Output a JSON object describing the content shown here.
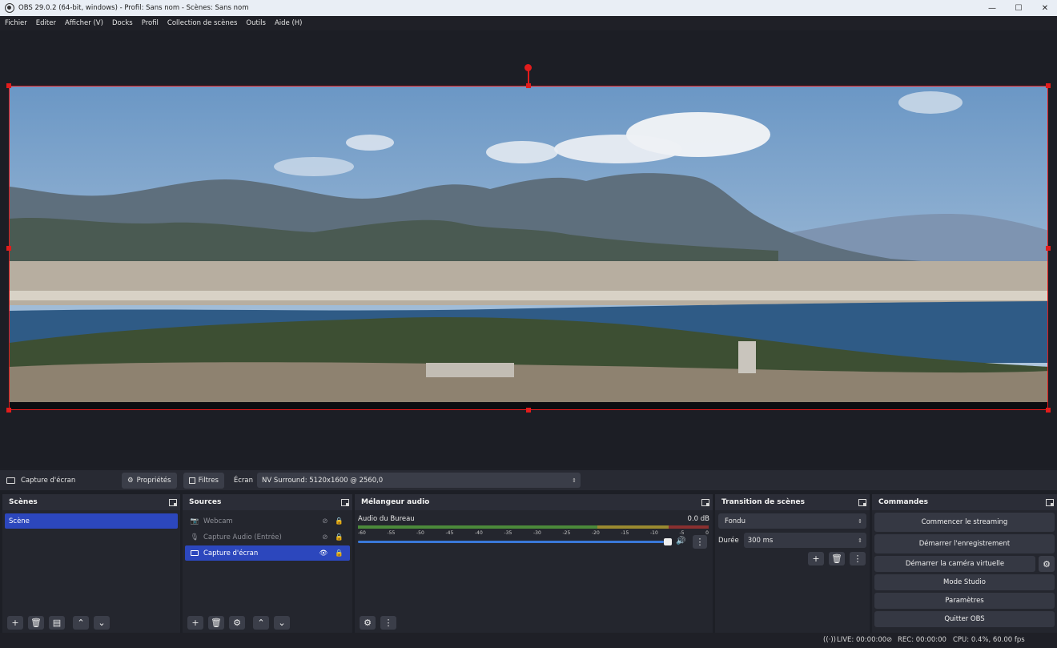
{
  "window": {
    "title": "OBS 29.0.2 (64-bit, windows) - Profil: Sans nom - Scènes: Sans nom",
    "minimize": "—",
    "maximize": "☐",
    "close": "✕"
  },
  "menu": [
    "Fichier",
    "Editer",
    "Afficher (V)",
    "Docks",
    "Profil",
    "Collection de scènes",
    "Outils",
    "Aide (H)"
  ],
  "source_toolbar": {
    "source_name": "Capture d'écran",
    "properties_label": "Propriétés",
    "filters_label": "Filtres",
    "screen_label": "Écran",
    "screen_value": "NV Surround: 5120x1600 @ 2560,0"
  },
  "scenes": {
    "title": "Scènes",
    "items": [
      "Scène"
    ]
  },
  "sources": {
    "title": "Sources",
    "items": [
      {
        "name": "Webcam",
        "icon": "camera-icon",
        "visible": false,
        "selected": false
      },
      {
        "name": "Capture Audio (Entrée)",
        "icon": "microphone-icon",
        "visible": false,
        "selected": false
      },
      {
        "name": "Capture d'écran",
        "icon": "monitor-icon",
        "visible": true,
        "selected": true
      }
    ]
  },
  "mixer": {
    "title": "Mélangeur audio",
    "channel_name": "Audio du Bureau",
    "level": "0.0 dB",
    "ticks": [
      "-60",
      "-55",
      "-50",
      "-45",
      "-40",
      "-35",
      "-30",
      "-25",
      "-20",
      "-15",
      "-10",
      "-5",
      "0"
    ],
    "volume_fraction": 1.0
  },
  "transitions": {
    "title": "Transition de scènes",
    "selected": "Fondu",
    "duration_label": "Durée",
    "duration_value": "300 ms"
  },
  "controls": {
    "title": "Commandes",
    "start_streaming": "Commencer le streaming",
    "start_recording": "Démarrer l'enregistrement",
    "start_virtual_cam": "Démarrer la caméra virtuelle",
    "studio_mode": "Mode Studio",
    "settings": "Paramètres",
    "exit": "Quitter OBS"
  },
  "status": {
    "live": "LIVE: 00:00:00",
    "rec": "REC: 00:00:00",
    "cpu": "CPU: 0.4%, 60.00 fps"
  },
  "colors": {
    "selection": "#2c47bd",
    "canvas_border": "#e21c1c",
    "meter_green": "#4b8a3a",
    "meter_yellow": "#9a8a30",
    "meter_red": "#8a3030",
    "volume_blue": "#3a78d8"
  }
}
